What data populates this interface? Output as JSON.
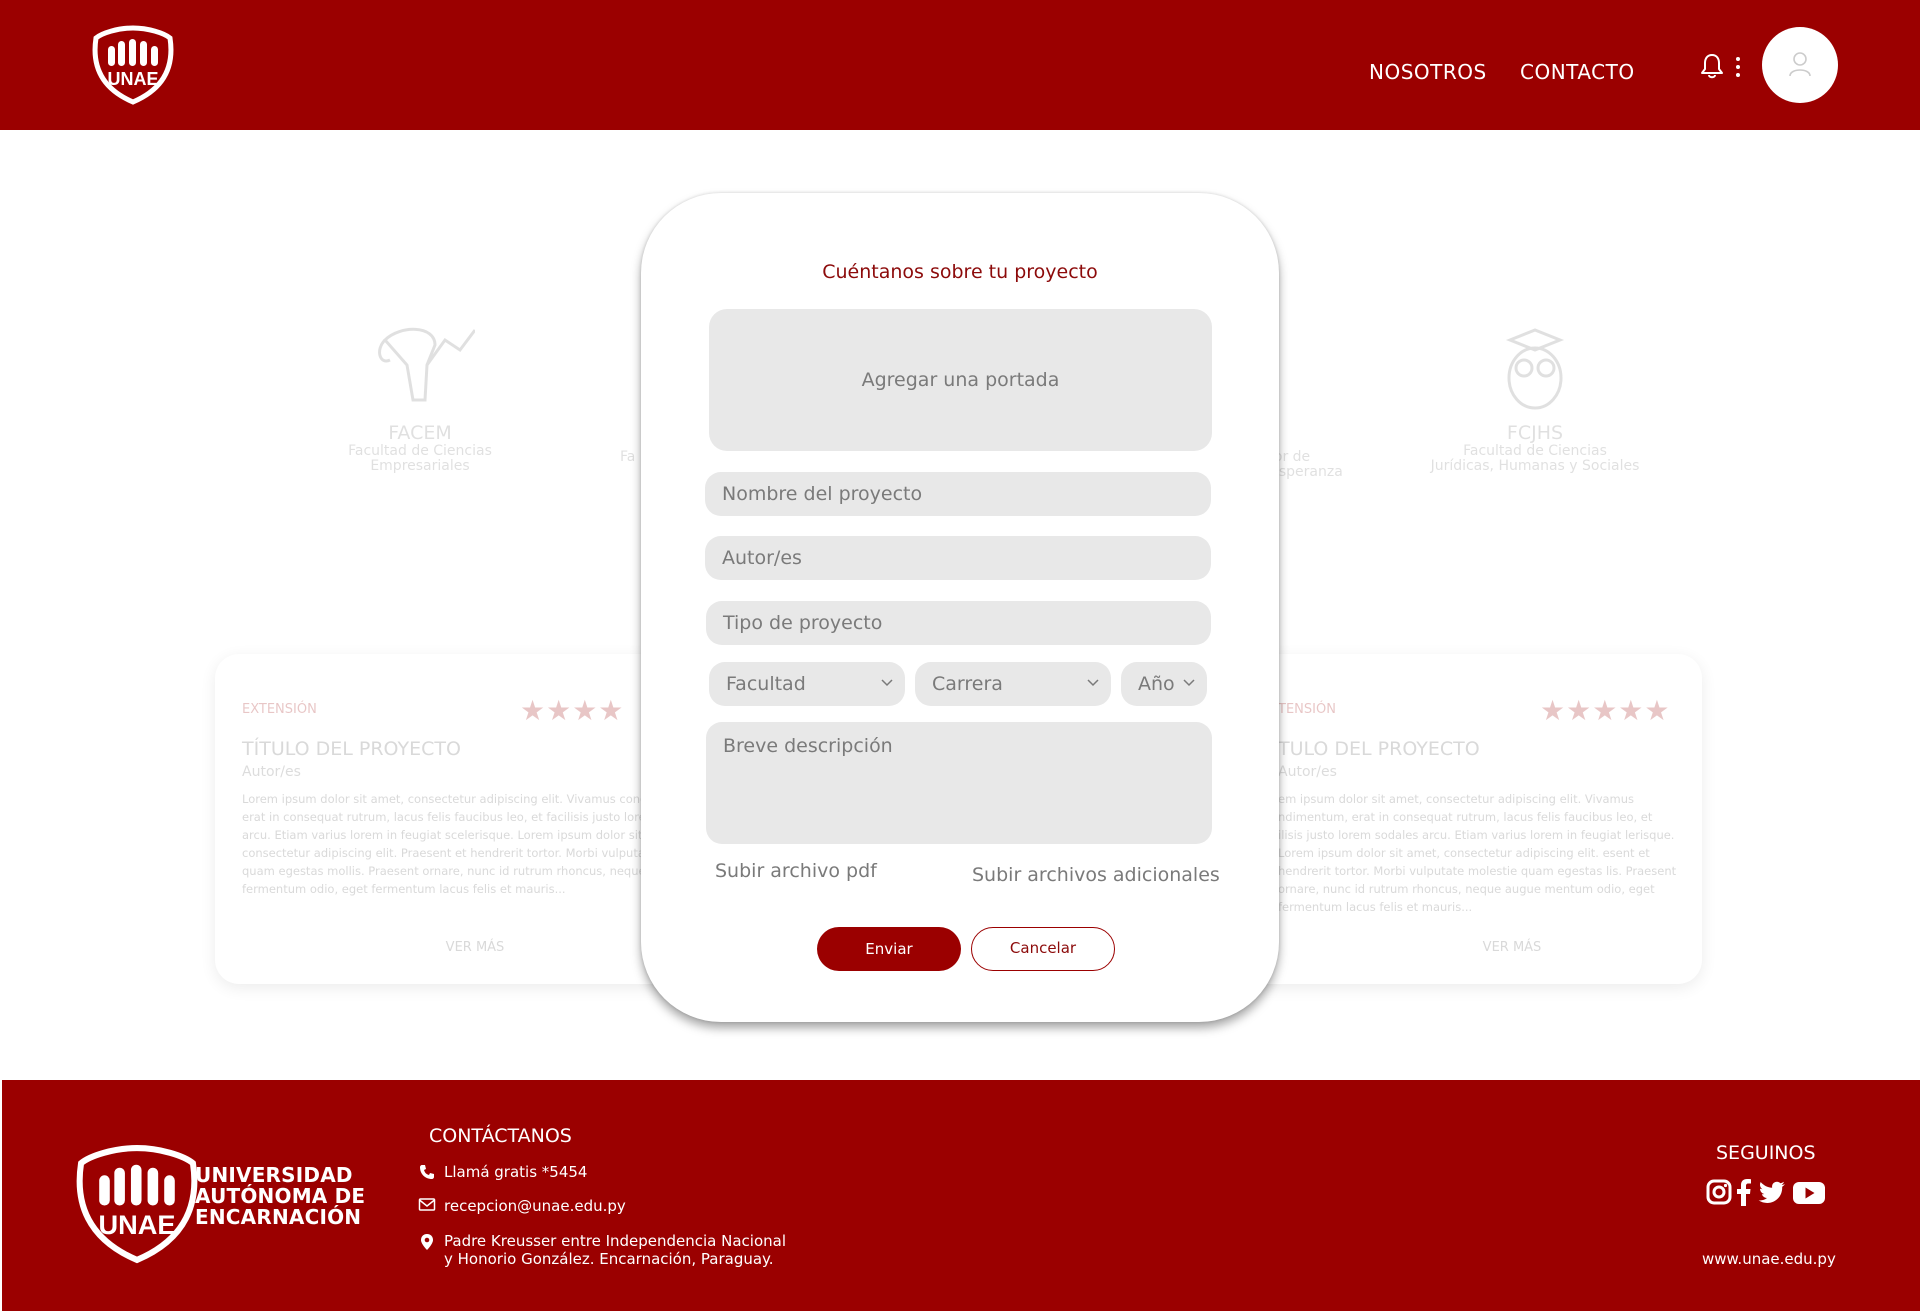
{
  "header": {
    "logo_text": "UNAE",
    "nav": [
      "NOSOTROS",
      "CONTACTO"
    ],
    "icons": [
      "bell-icon",
      "more-vertical-icon",
      "user-icon"
    ]
  },
  "background": {
    "faculties": [
      {
        "abbr": "FACEM",
        "name_l1": "Facultad de Ciencias",
        "name_l2": "Empresariales"
      },
      {
        "abbr": "Fa",
        "name_l1": "Fa",
        "name_l2": ""
      },
      {
        "abbr": "",
        "name_l1": "lor de",
        "name_l2": "Esperanza"
      },
      {
        "abbr": "FCJHS",
        "name_l1": "Facultad de Ciencias",
        "name_l2": "Jurídicas, Humanas y Sociales"
      }
    ],
    "cards": [
      {
        "tag": "EXTENSIÓN",
        "stars": "★★★★",
        "title": "TÍTULO DEL PROYECTO",
        "author": "Autor/es",
        "desc": "Lorem ipsum dolor sit amet, consectetur adipiscing elit. Vivamus condimentum, erat in consequat rutrum, lacus felis faucibus leo, et facilisis justo lorem sodales arcu. Etiam varius lorem in feugiat scelerisque. Lorem ipsum dolor sit amet, consectetur adipiscing elit. Praesent et hendrerit tortor. Morbi vulputate molestie quam egestas mollis. Praesent ornare, nunc id rutrum rhoncus, neque augue fermentum odio, eget fermentum lacus felis et mauris...",
        "more": "VER MÁS"
      },
      {
        "tag": "TENSIÓN",
        "stars": "★★★★★",
        "title": "TULO DEL PROYECTO",
        "author": "Autor/es",
        "desc": "em ipsum dolor sit amet, consectetur adipiscing elit. Vivamus ndimentum, erat in consequat rutrum, lacus felis faucibus leo, et ilisis justo lorem sodales arcu. Etiam varius lorem in feugiat lerisque. Lorem ipsum dolor sit amet, consectetur adipiscing elit. esent et hendrerit tortor. Morbi vulputate molestie quam egestas lis. Praesent ornare, nunc id rutrum rhoncus, neque augue mentum odio, eget fermentum lacus felis et mauris...",
        "more": "VER MÁS"
      }
    ]
  },
  "modal": {
    "title": "Cuéntanos sobre tu proyecto",
    "cover_label": "Agregar una portada",
    "fields": {
      "nombre": "Nombre del proyecto",
      "autor": "Autor/es",
      "tipo": "Tipo de proyecto",
      "facultad": "Facultad",
      "carrera": "Carrera",
      "anio": "Año",
      "descripcion": "Breve descripción"
    },
    "upload_pdf": "Subir archivo pdf",
    "upload_additional": "Subir archivos adicionales",
    "send_label": "Enviar",
    "cancel_label": "Cancelar"
  },
  "footer": {
    "logo_text": "UNAE",
    "uni_name": [
      "UNIVERSIDAD",
      "AUTÓNOMA DE",
      "ENCARNACIÓN"
    ],
    "contact_title": "CONTÁCTANOS",
    "phone": "Llamá gratis *5454",
    "email": "recepcion@unae.edu.py",
    "address_l1": "Padre Kreusser entre Independencia Nacional",
    "address_l2": "y Honorio González. Encarnación, Paraguay.",
    "follow_title": "SEGUINOS",
    "social": [
      "instagram-icon",
      "facebook-icon",
      "twitter-icon",
      "youtube-icon"
    ],
    "website": "www.unae.edu.py"
  },
  "colors": {
    "brand": "#9b0000",
    "field_bg": "#e8e8e8",
    "placeholder": "#7a7a7a"
  }
}
